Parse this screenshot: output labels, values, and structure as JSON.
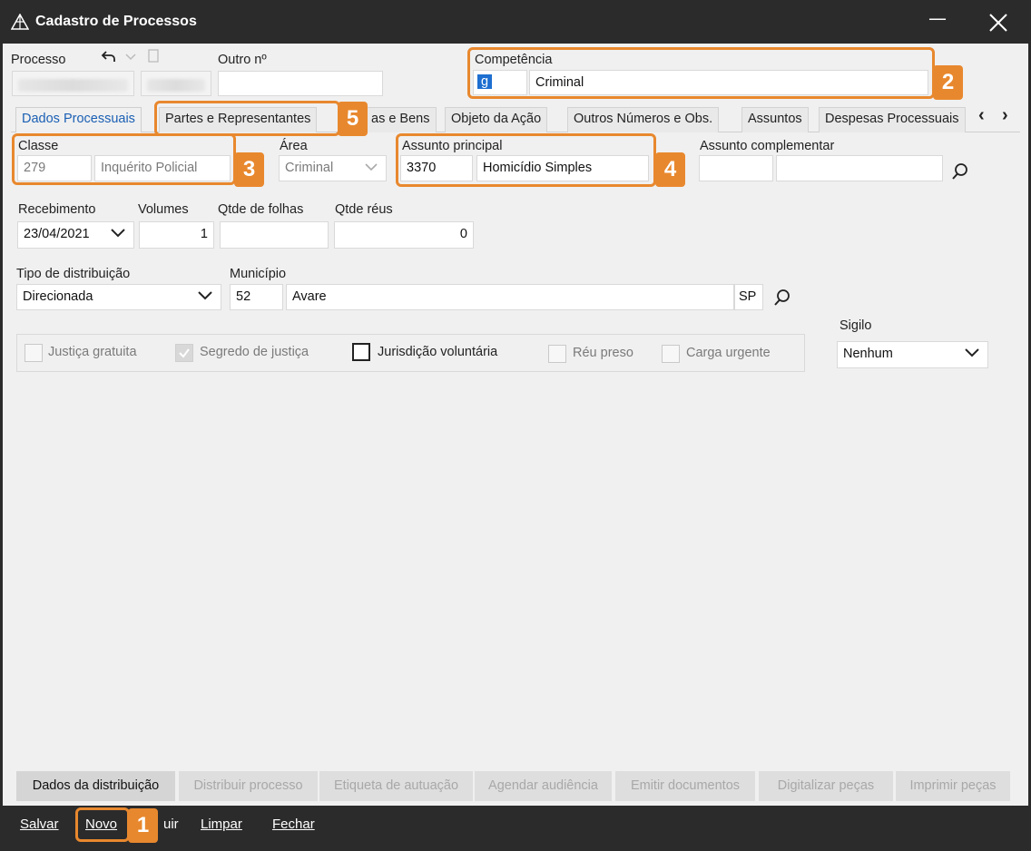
{
  "window": {
    "title": "Cadastro de Processos",
    "minimize": "—"
  },
  "header": {
    "processo_label": "Processo",
    "outro_label": "Outro nº",
    "competencia_label": "Competência",
    "competencia_code": "g",
    "competencia_value": "Criminal"
  },
  "tabs": {
    "t0": "Dados Processuais",
    "t1": "Partes e Representantes",
    "t2": "as e Bens",
    "t3": "Objeto da Ação",
    "t4": "Outros Números e Obs.",
    "t5": "Assuntos",
    "t6": "Despesas Processuais",
    "prev": "‹",
    "next": "›"
  },
  "form": {
    "classe_label": "Classe",
    "classe_code": "279",
    "classe_name": "Inquérito Policial",
    "area_label": "Área",
    "area_value": "Criminal",
    "assunto_label": "Assunto principal",
    "assunto_code": "3370",
    "assunto_name": "Homicídio Simples",
    "assunto_comp_label": "Assunto complementar",
    "recebimento_label": "Recebimento",
    "recebimento_value": "23/04/2021",
    "volumes_label": "Volumes",
    "volumes_value": "1",
    "folhas_label": "Qtde de folhas",
    "reus_label": "Qtde réus",
    "reus_value": "0",
    "tipo_label": "Tipo de distribuição",
    "tipo_value": "Direcionada",
    "municipio_label": "Município",
    "municipio_code": "52",
    "municipio_name": "Avare",
    "municipio_uf": "SP",
    "sigilo_label": "Sigilo",
    "sigilo_value": "Nenhum",
    "chk_justica": "Justiça gratuita",
    "chk_segredo": "Segredo de justiça",
    "chk_jurisdicao": "Jurisdição voluntária",
    "chk_reu": "Réu preso",
    "chk_carga": "Carga urgente"
  },
  "actions": {
    "a0": "Dados da distribuição",
    "a1": "Distribuir processo",
    "a2": "Etiqueta de autuação",
    "a3": "Agendar audiência",
    "a4": "Emitir documentos",
    "a5": "Digitalizar peças",
    "a6": "Imprimir peças"
  },
  "footer": {
    "salvar": "Salvar",
    "novo": "Novo",
    "excluir_partial": "uir",
    "limpar": "Limpar",
    "fechar": "Fechar"
  },
  "badges": {
    "b1": "1",
    "b2": "2",
    "b3": "3",
    "b4": "4",
    "b5": "5"
  },
  "colors": {
    "accent_orange": "#e8882e",
    "titlebar": "#2b2b2b",
    "active_tab": "#1a5fb4"
  }
}
